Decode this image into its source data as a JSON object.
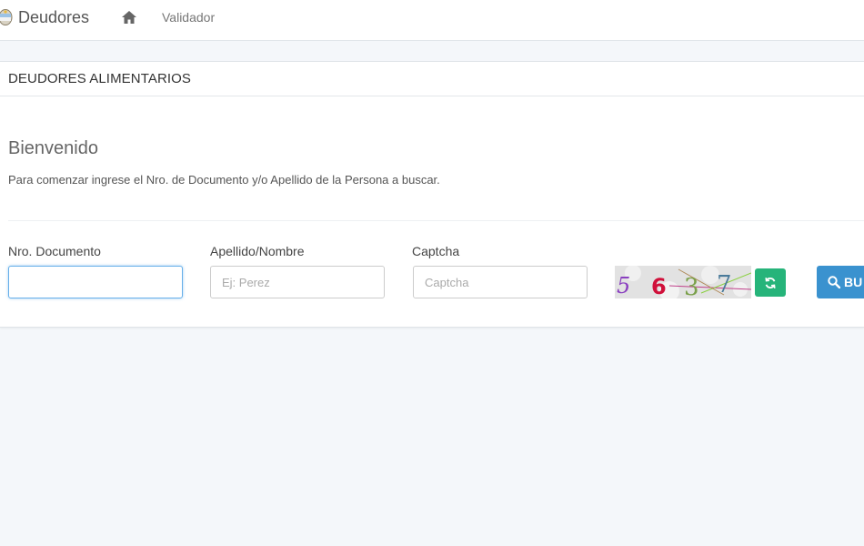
{
  "navbar": {
    "brand": "Deudores",
    "home_icon": "home-icon",
    "link_validador": "Validador"
  },
  "panel": {
    "title": "DEUDORES ALIMENTARIOS"
  },
  "welcome": {
    "title": "Bienvenido",
    "text": "Para comenzar ingrese el Nro. de Documento y/o Apellido de la Persona a buscar."
  },
  "form": {
    "documento": {
      "label": "Nro. Documento",
      "value": "",
      "placeholder": ""
    },
    "apellido": {
      "label": "Apellido/Nombre",
      "value": "",
      "placeholder": "Ej: Perez"
    },
    "captcha": {
      "label": "Captcha",
      "value": "",
      "placeholder": "Captcha"
    },
    "captcha_image": {
      "digits": [
        "5",
        "6",
        "3",
        "7"
      ]
    },
    "refresh_icon": "refresh-icon",
    "search_button": {
      "label": "BU",
      "icon": "search-icon"
    }
  },
  "colors": {
    "page_background": "#f4f7fa",
    "refresh_green": "#26b47a",
    "search_blue": "#3a92cf",
    "focus_blue": "#66afe9"
  }
}
